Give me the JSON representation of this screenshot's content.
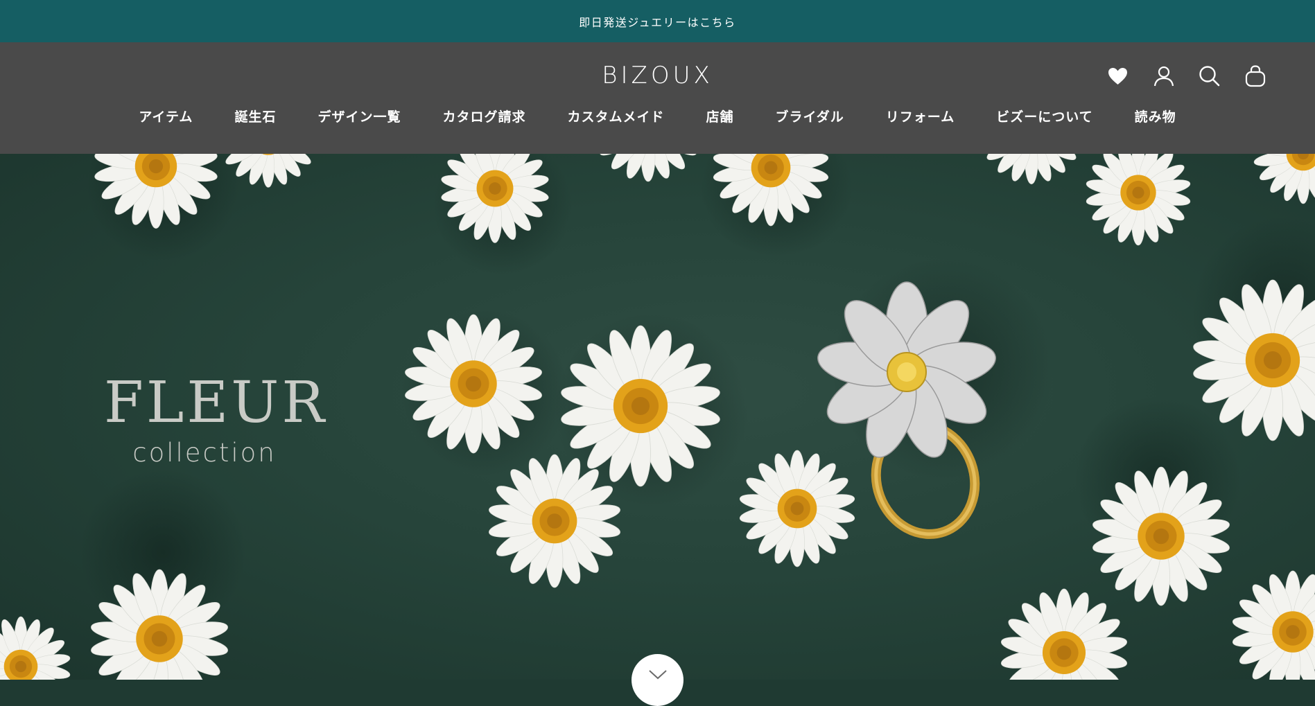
{
  "announcement": {
    "text": "即日発送ジュエリーはこちら"
  },
  "header": {
    "logo": "BIZOUX",
    "icons": [
      "heart-icon",
      "account-icon",
      "search-icon",
      "bag-icon"
    ]
  },
  "nav": {
    "items": [
      {
        "label": "アイテム"
      },
      {
        "label": "誕生石"
      },
      {
        "label": "デザイン一覧"
      },
      {
        "label": "カタログ請求"
      },
      {
        "label": "カスタムメイド"
      },
      {
        "label": "店舗"
      },
      {
        "label": "ブライダル"
      },
      {
        "label": "リフォーム"
      },
      {
        "label": "ビズーについて"
      },
      {
        "label": "読み物"
      }
    ]
  },
  "hero": {
    "title": "FLEUR",
    "subtitle": "collection",
    "scroll_icon": "chevron-down-icon"
  },
  "colors": {
    "announcement_bg": "#155e63",
    "header_bg": "#4a4a4a",
    "hero_bg": "#26443a",
    "text_light": "#ffffff"
  }
}
